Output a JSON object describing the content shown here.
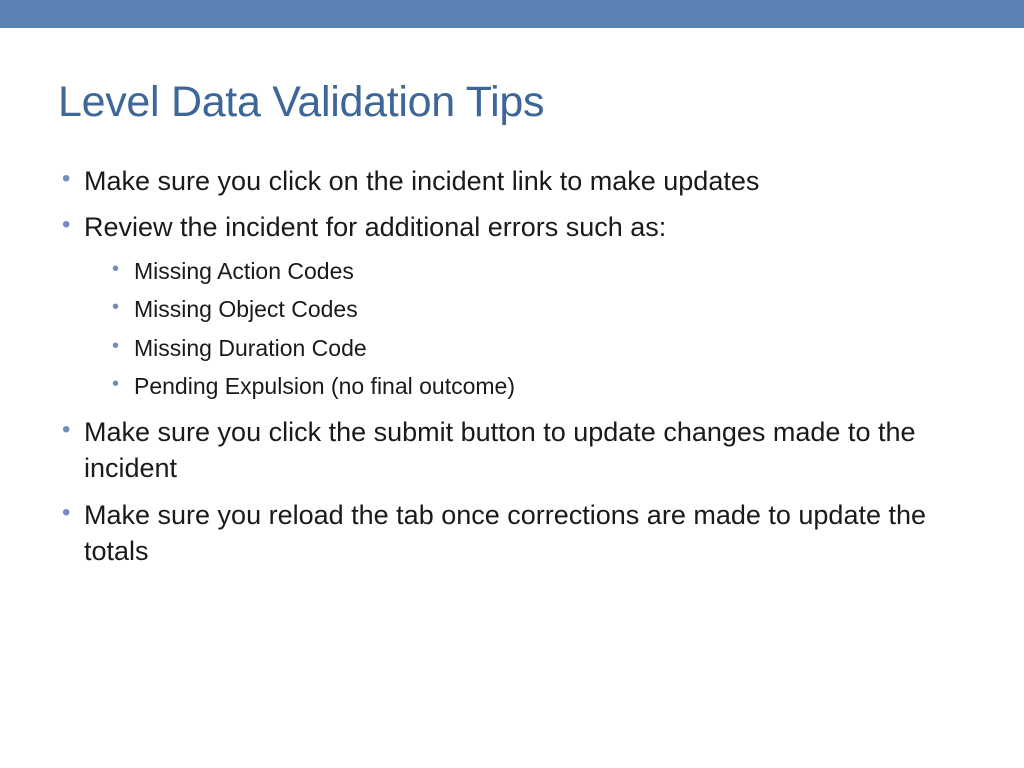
{
  "slide": {
    "title": "Level Data Validation Tips",
    "bullets": {
      "b1": "Make sure you click on the incident link to make updates",
      "b2": "Review the incident for additional errors such as:",
      "b2_sub": {
        "s1": "Missing Action Codes",
        "s2": "Missing Object Codes",
        "s3": "Missing Duration Code",
        "s4": "Pending Expulsion (no final outcome)"
      },
      "b3": "Make sure you click the submit button to update changes made to the incident",
      "b4": "Make sure you reload the tab once corrections are made to update the totals"
    }
  }
}
